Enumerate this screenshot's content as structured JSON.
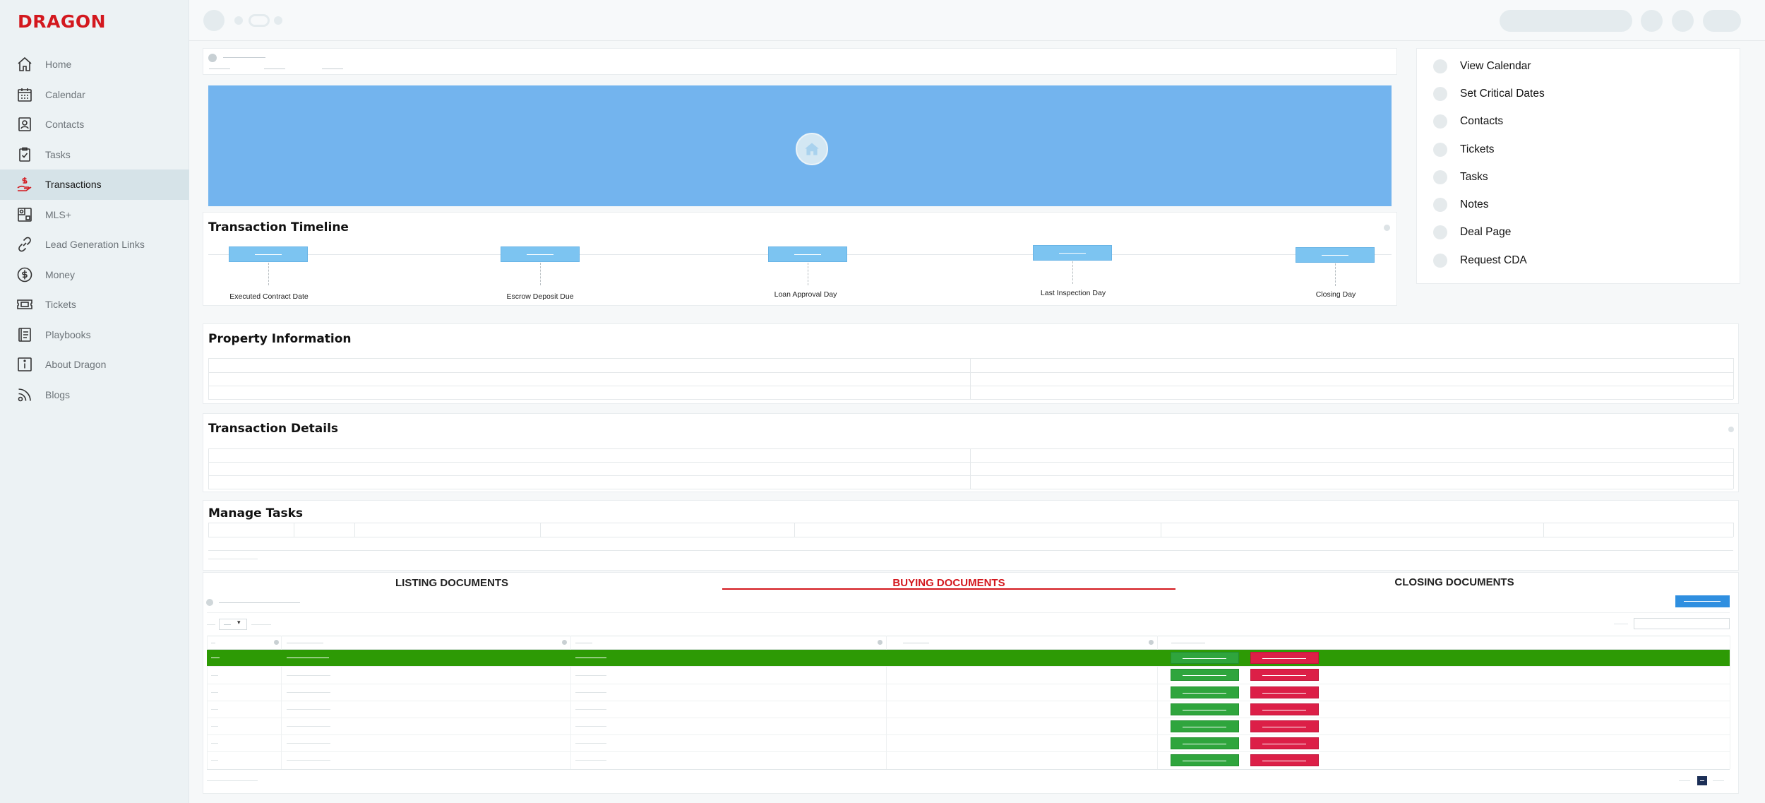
{
  "brand": {
    "name": "DRAGON",
    "color": "#d3181e"
  },
  "sidebar": {
    "items": [
      {
        "label": "Home",
        "icon": "home-icon"
      },
      {
        "label": "Calendar",
        "icon": "calendar-icon"
      },
      {
        "label": "Contacts",
        "icon": "contacts-icon"
      },
      {
        "label": "Tasks",
        "icon": "tasks-icon"
      },
      {
        "label": "Transactions",
        "icon": "transactions-icon",
        "active": true
      },
      {
        "label": "MLS+",
        "icon": "mls-icon"
      },
      {
        "label": "Lead Generation Links",
        "icon": "link-icon"
      },
      {
        "label": "Money",
        "icon": "money-icon"
      },
      {
        "label": "Tickets",
        "icon": "ticket-icon"
      },
      {
        "label": "Playbooks",
        "icon": "playbook-icon"
      },
      {
        "label": "About Dragon",
        "icon": "info-icon"
      },
      {
        "label": "Blogs",
        "icon": "blog-icon"
      }
    ]
  },
  "timeline": {
    "title": "Transaction Timeline",
    "events": [
      {
        "label": "Executed Contract Date"
      },
      {
        "label": "Escrow Deposit Due"
      },
      {
        "label": "Loan Approval Day"
      },
      {
        "label": "Last Inspection Day"
      },
      {
        "label": "Closing Day"
      }
    ]
  },
  "quick_actions": [
    "View Calendar",
    "Set Critical Dates",
    "Contacts",
    "Tickets",
    "Tasks",
    "Notes",
    "Deal Page",
    "Request CDA"
  ],
  "sections": {
    "property_information": "Property Information",
    "transaction_details": "Transaction Details",
    "manage_tasks": "Manage Tasks"
  },
  "documents": {
    "tabs": [
      {
        "label": "LISTING DOCUMENTS"
      },
      {
        "label": "BUYING DOCUMENTS",
        "active": true
      },
      {
        "label": "CLOSING DOCUMENTS"
      }
    ],
    "row_count": 7,
    "colors": {
      "selected_row": "#2d9a05",
      "view_button": "#2fa53d",
      "delete_button": "#dc1f47",
      "primary": "#2f8fe0"
    }
  }
}
